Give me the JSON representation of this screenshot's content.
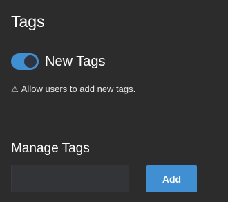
{
  "settings": {
    "title": "Tags",
    "new_tags_toggle": {
      "label": "New Tags",
      "enabled": true
    },
    "warning": {
      "icon": "warning-triangle-icon",
      "glyph": "⚠",
      "text": "Allow users to add new tags."
    }
  },
  "manage": {
    "title": "Manage Tags",
    "input_value": "",
    "input_placeholder": "",
    "add_label": "Add"
  },
  "colors": {
    "background": "#2c2c2d",
    "accent": "#3f8fd2",
    "input_background": "#333437"
  }
}
